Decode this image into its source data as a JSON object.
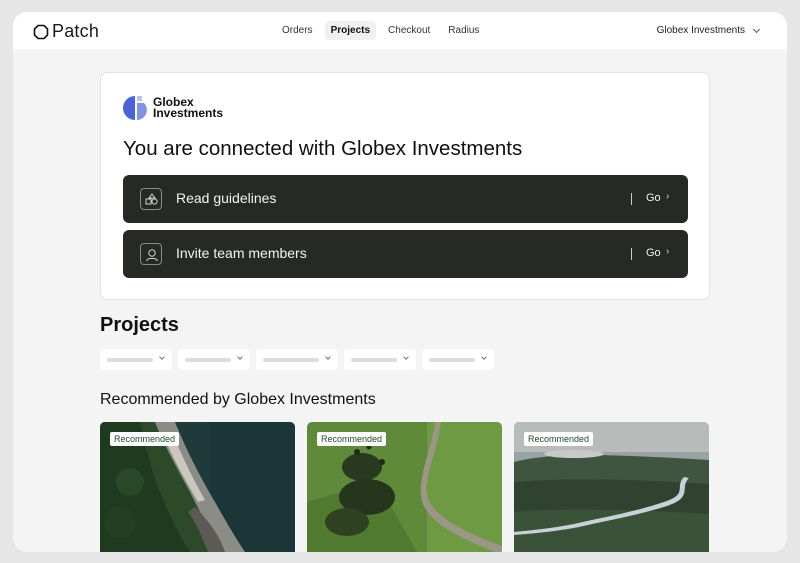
{
  "app": {
    "name": "Patch"
  },
  "nav": {
    "items": [
      {
        "label": "Orders",
        "active": false
      },
      {
        "label": "Projects",
        "active": true
      },
      {
        "label": "Checkout",
        "active": false
      },
      {
        "label": "Radius",
        "active": false
      }
    ]
  },
  "account": {
    "name": "Globex Investments"
  },
  "connection": {
    "brand_line1": "Globex",
    "brand_line2": "Investments",
    "title": "You are connected with Globex Investments",
    "actions": [
      {
        "label": "Read guidelines",
        "go": "Go",
        "icon": "shapes-icon"
      },
      {
        "label": "Invite team members",
        "go": "Go",
        "icon": "user-icon"
      }
    ]
  },
  "projects": {
    "title": "Projects",
    "filter_count": 5
  },
  "recommended": {
    "title": "Recommended by Globex Investments",
    "tiles": [
      {
        "badge": "Recommended",
        "image": "aerial-coast"
      },
      {
        "badge": "Recommended",
        "image": "aerial-field-road"
      },
      {
        "badge": "Recommended",
        "image": "aerial-river-forest"
      }
    ]
  },
  "colors": {
    "action_bg": "#272a24",
    "brand_blue": "#4b63d8",
    "badge_text": "#1d4a2a"
  }
}
